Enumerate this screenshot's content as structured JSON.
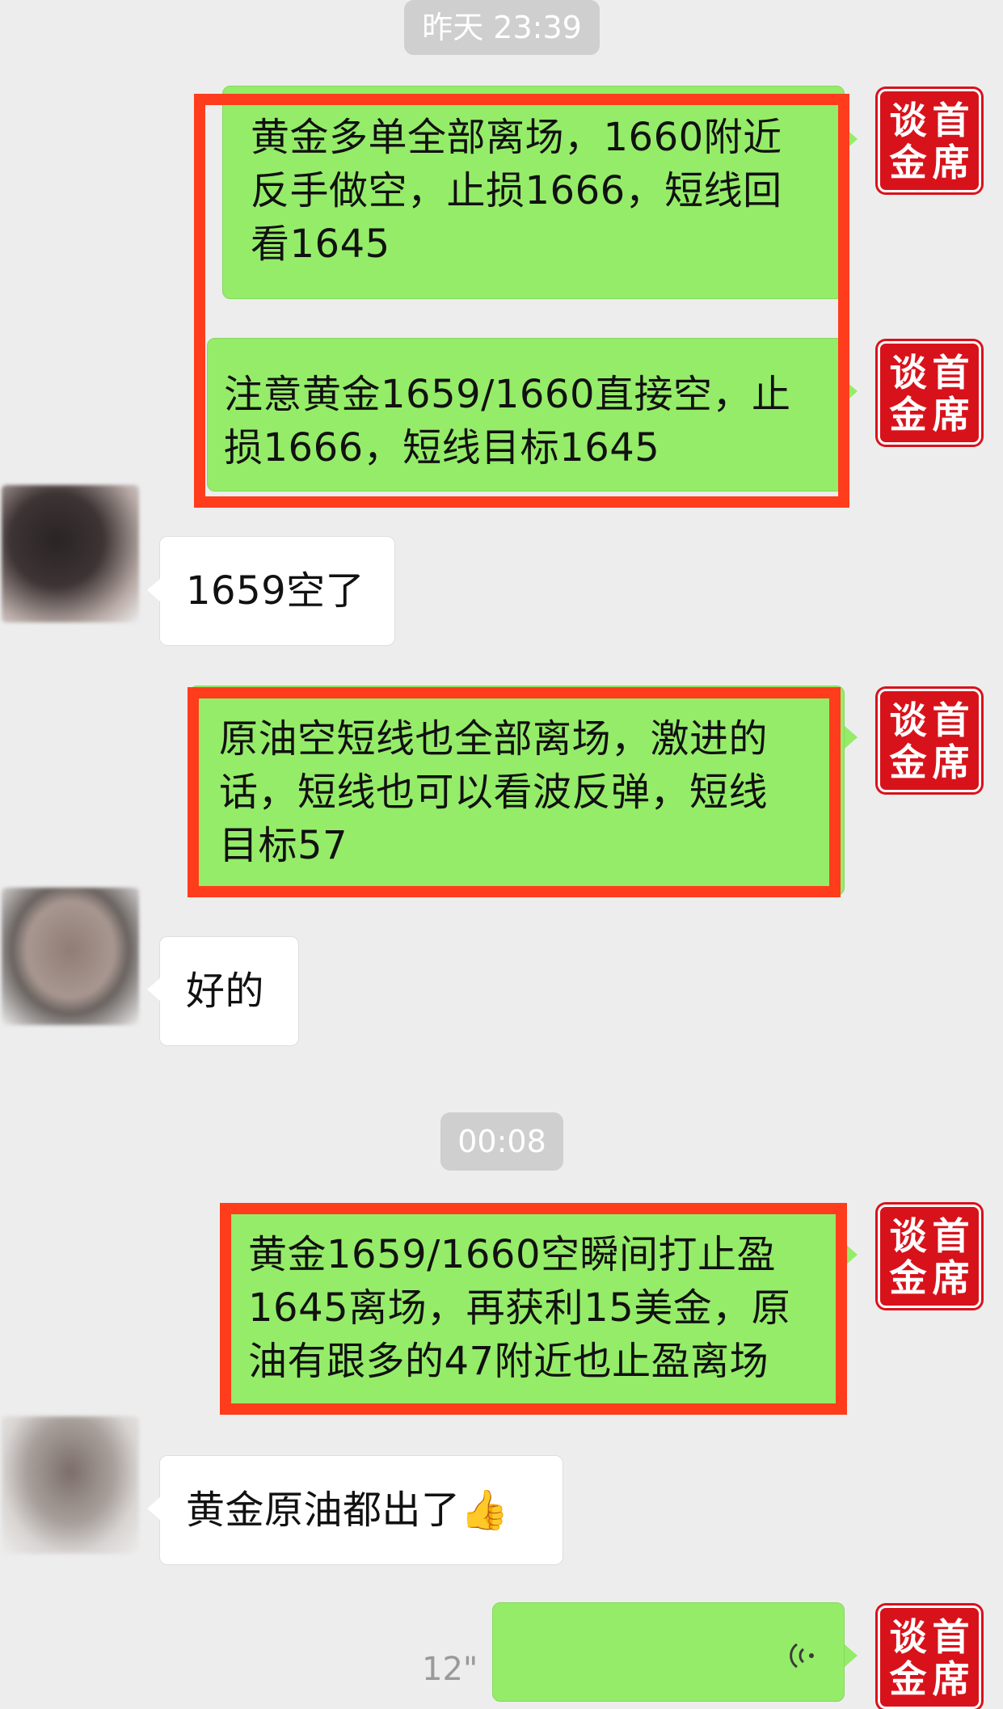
{
  "timestamps": {
    "first": "昨天 23:39",
    "second": "00:08"
  },
  "seal_text": [
    "谈",
    "首",
    "金",
    "席"
  ],
  "messages": [
    {
      "side": "right",
      "text": "黄金多单全部离场，1660附近\n反手做空，止损1666，短线回\n看1645"
    },
    {
      "side": "right",
      "text": "注意黄金1659/1660直接空，止\n损1666，短线目标1645"
    },
    {
      "side": "left",
      "text": "1659空了"
    },
    {
      "side": "right",
      "text": "原油空短线也全部离场，激进的\n话，短线也可以看波反弹，短线\n目标57"
    },
    {
      "side": "left",
      "text": "好的"
    },
    {
      "side": "right",
      "text": "黄金1659/1660空瞬间打止盈\n1645离场，再获利15美金，原\n油有跟多的47附近也止盈离场"
    },
    {
      "side": "left",
      "text": "黄金原油都出了👍"
    },
    {
      "side": "right",
      "type": "voice",
      "duration": "12\""
    }
  ],
  "colors": {
    "background": "#ededed",
    "sent_bubble": "#95ec69",
    "received_bubble": "#ffffff",
    "highlight_box": "#ff3d1c",
    "seal": "#d8121b"
  },
  "icons": {
    "voice": "voice-wave-icon",
    "thumbs_up": "thumbs-up-emoji"
  }
}
